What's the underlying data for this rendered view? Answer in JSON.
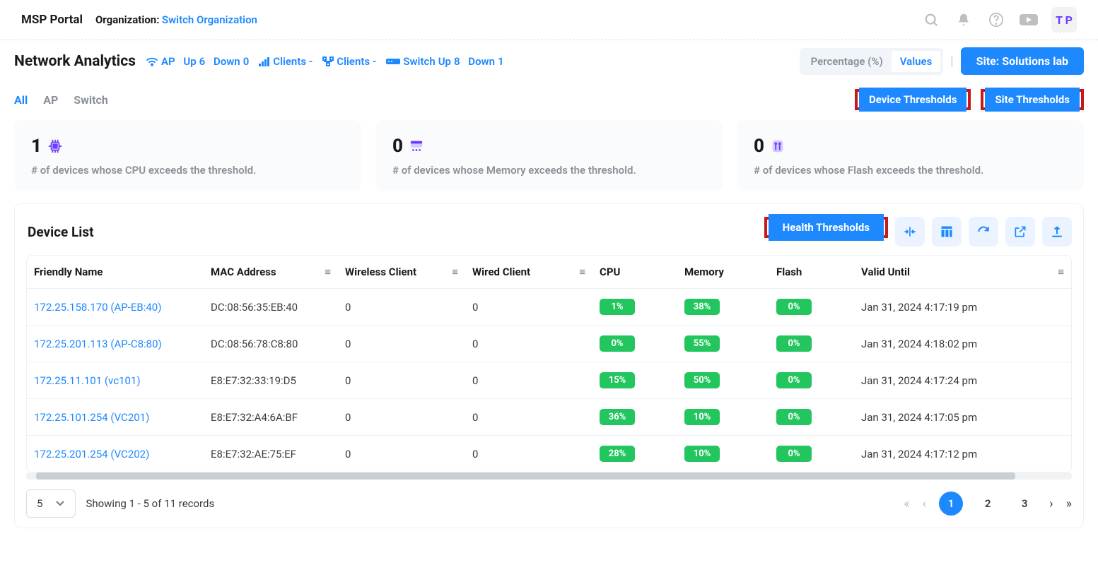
{
  "header": {
    "brand": "MSP Portal",
    "org_label": "Organization:",
    "org_link": "Switch Organization",
    "avatar": "T P"
  },
  "subhead": {
    "title": "Network Analytics",
    "ap_label": "AP",
    "ap_up_label": "Up",
    "ap_up": "6",
    "ap_down_label": "Down",
    "ap_down": "0",
    "clients_wireless": "Clients -",
    "clients_wired": "Clients -",
    "switch_label": "Switch",
    "switch_up_label": "Up",
    "switch_up": "8",
    "switch_down_label": "Down",
    "switch_down": "1",
    "toggle_pct": "Percentage (%)",
    "toggle_val": "Values",
    "site_btn": "Site: Solutions lab"
  },
  "tabs": {
    "all": "All",
    "ap": "AP",
    "switch": "Switch",
    "device_thresholds": "Device Thresholds",
    "site_thresholds": "Site Thresholds"
  },
  "cards": [
    {
      "count": "1",
      "desc": "# of devices whose CPU exceeds the threshold."
    },
    {
      "count": "0",
      "desc": "# of devices whose Memory exceeds the threshold."
    },
    {
      "count": "0",
      "desc": "# of devices whose Flash exceeds the threshold."
    }
  ],
  "device_list": {
    "title": "Device List",
    "health_btn": "Health Thresholds",
    "columns": {
      "name": "Friendly Name",
      "mac": "MAC Address",
      "wireless": "Wireless Client",
      "wired": "Wired Client",
      "cpu": "CPU",
      "memory": "Memory",
      "flash": "Flash",
      "valid": "Valid Until"
    },
    "rows": [
      {
        "name": "172.25.158.170 (AP-EB:40)",
        "mac": "DC:08:56:35:EB:40",
        "wireless": "0",
        "wired": "0",
        "cpu": "1%",
        "memory": "38%",
        "flash": "0%",
        "valid": "Jan 31, 2024 4:17:19 pm"
      },
      {
        "name": "172.25.201.113 (AP-C8:80)",
        "mac": "DC:08:56:78:C8:80",
        "wireless": "0",
        "wired": "0",
        "cpu": "0%",
        "memory": "55%",
        "flash": "0%",
        "valid": "Jan 31, 2024 4:18:02 pm"
      },
      {
        "name": "172.25.11.101 (vc101)",
        "mac": "E8:E7:32:33:19:D5",
        "wireless": "0",
        "wired": "0",
        "cpu": "15%",
        "memory": "50%",
        "flash": "0%",
        "valid": "Jan 31, 2024 4:17:24 pm"
      },
      {
        "name": "172.25.101.254 (VC201)",
        "mac": "E8:E7:32:A4:6A:BF",
        "wireless": "0",
        "wired": "0",
        "cpu": "36%",
        "memory": "10%",
        "flash": "0%",
        "valid": "Jan 31, 2024 4:17:05 pm"
      },
      {
        "name": "172.25.201.254 (VC202)",
        "mac": "E8:E7:32:AE:75:EF",
        "wireless": "0",
        "wired": "0",
        "cpu": "28%",
        "memory": "10%",
        "flash": "0%",
        "valid": "Jan 31, 2024 4:17:12 pm"
      }
    ]
  },
  "pagination": {
    "page_size": "5",
    "summary": "Showing 1 - 5 of 11 records",
    "pages": [
      "1",
      "2",
      "3"
    ]
  }
}
